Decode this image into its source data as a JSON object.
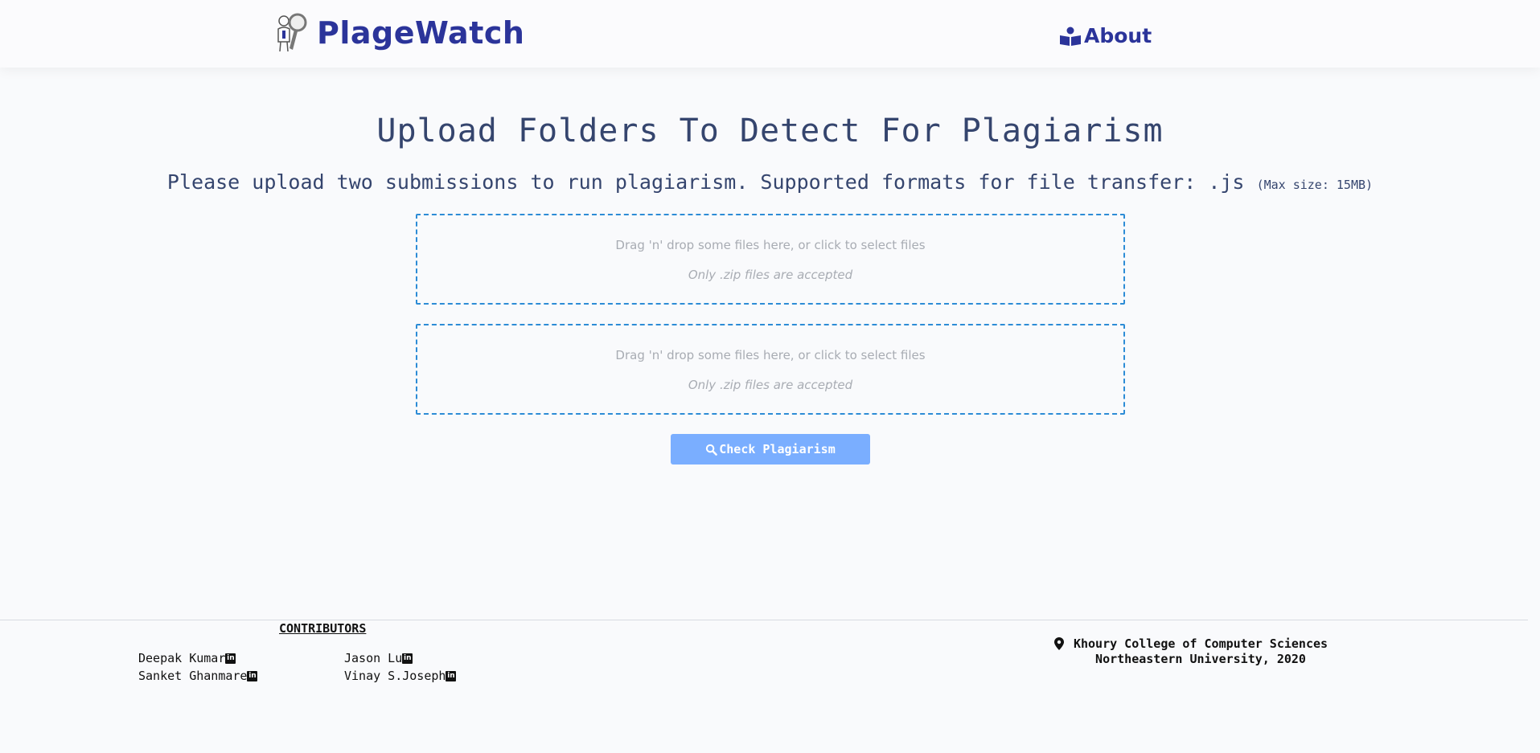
{
  "navbar": {
    "brand_name": "PlageWatch",
    "about_label": "About",
    "brand_color": "#2b349a"
  },
  "main": {
    "title": "Upload Folders To Detect For Plagiarism",
    "subtitle": "Please upload two submissions to run plagiarism. Supported formats for file transfer: .js",
    "max_size": "(Max size: 15MB)",
    "dropzones": [
      {
        "prompt": "Drag 'n' drop some files here, or click to select files",
        "note": "Only .zip files are accepted"
      },
      {
        "prompt": "Drag 'n' drop some files here, or click to select files",
        "note": "Only .zip files are accepted"
      }
    ],
    "check_button_label": "Check Plagiarism",
    "dropzone_border_color": "#2d8cd6",
    "button_color": "#7aaeff"
  },
  "footer": {
    "contributors_heading": "CONTRIBUTORS",
    "contributors": [
      {
        "name": "Deepak Kumar",
        "icon": "linkedin-icon"
      },
      {
        "name": "Jason Lu",
        "icon": "linkedin-icon"
      },
      {
        "name": "Sanket Ghanmare",
        "icon": "linkedin-icon"
      },
      {
        "name": "Vinay S.Joseph",
        "icon": "linkedin-icon"
      }
    ],
    "address_line1": "Khoury College of Computer Sciences",
    "address_line2": "Northeastern University, 2020"
  }
}
